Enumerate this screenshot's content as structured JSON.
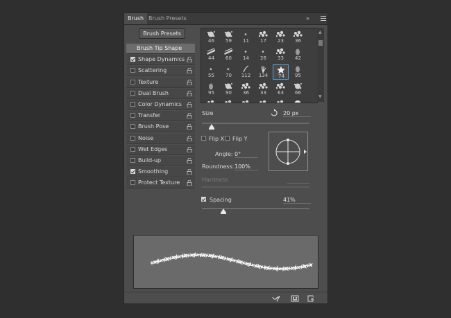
{
  "tabs": {
    "brush": "Brush",
    "brush_presets": "Brush Presets"
  },
  "tabbar_icons": {
    "collapse": "»",
    "menu": "hamburger-menu-icon"
  },
  "brush_presets_button": "Brush Presets",
  "options": [
    {
      "label": "Brush Tip Shape",
      "checkbox": null,
      "lock": false
    },
    {
      "label": "Shape Dynamics",
      "checkbox": true,
      "lock": true
    },
    {
      "label": "Scattering",
      "checkbox": false,
      "lock": true
    },
    {
      "label": "Texture",
      "checkbox": false,
      "lock": true
    },
    {
      "label": "Dual Brush",
      "checkbox": false,
      "lock": true
    },
    {
      "label": "Color Dynamics",
      "checkbox": false,
      "lock": true
    },
    {
      "label": "Transfer",
      "checkbox": false,
      "lock": true
    },
    {
      "label": "Brush Pose",
      "checkbox": false,
      "lock": true
    },
    {
      "label": "Noise",
      "checkbox": false,
      "lock": true
    },
    {
      "label": "Wet Edges",
      "checkbox": false,
      "lock": true
    },
    {
      "label": "Build-up",
      "checkbox": false,
      "lock": true
    },
    {
      "label": "Smoothing",
      "checkbox": true,
      "lock": true
    },
    {
      "label": "Protect Texture",
      "checkbox": false,
      "lock": true
    }
  ],
  "brush_tips": [
    {
      "num": "46",
      "shape": "splat"
    },
    {
      "num": "59",
      "shape": "splat"
    },
    {
      "num": "11",
      "shape": "dot-small"
    },
    {
      "num": "17",
      "shape": "scatter"
    },
    {
      "num": "23",
      "shape": "scatter"
    },
    {
      "num": "36",
      "shape": "scatter"
    },
    {
      "num": "44",
      "shape": "streak"
    },
    {
      "num": "60",
      "shape": "streak"
    },
    {
      "num": "14",
      "shape": "dot-small"
    },
    {
      "num": "26",
      "shape": "dot-small"
    },
    {
      "num": "33",
      "shape": "scatter"
    },
    {
      "num": "42",
      "shape": "leaf"
    },
    {
      "num": "55",
      "shape": "star-small"
    },
    {
      "num": "70",
      "shape": "star-small"
    },
    {
      "num": "112",
      "shape": "stroke"
    },
    {
      "num": "134",
      "shape": "grass"
    },
    {
      "num": "74",
      "shape": "star"
    },
    {
      "num": "95",
      "shape": "leaf"
    },
    {
      "num": "95",
      "shape": "leaf"
    },
    {
      "num": "90",
      "shape": "splat"
    },
    {
      "num": "36",
      "shape": "scatter"
    },
    {
      "num": "33",
      "shape": "scatter"
    },
    {
      "num": "63",
      "shape": "scatter"
    },
    {
      "num": "66",
      "shape": "splat"
    }
  ],
  "selected_tip_index": 16,
  "size": {
    "label": "Size",
    "value": "20 px",
    "reset_icon": "reset-arrow-icon",
    "slider_fraction": 0.09
  },
  "flip": {
    "x_label": "Flip X",
    "y_label": "Flip Y",
    "x_checked": false,
    "y_checked": false
  },
  "angle": {
    "label": "Angle:",
    "value": "0°"
  },
  "roundness": {
    "label": "Roundness:",
    "value": "100%"
  },
  "hardness": {
    "label": "Hardness",
    "disabled": true
  },
  "spacing": {
    "label": "Spacing",
    "checked": true,
    "value": "41%",
    "slider_fraction": 0.2
  },
  "bottom_icons": [
    "toggle-brush-projection-icon",
    "create-new-preset-icon",
    "new-brush-icon"
  ]
}
